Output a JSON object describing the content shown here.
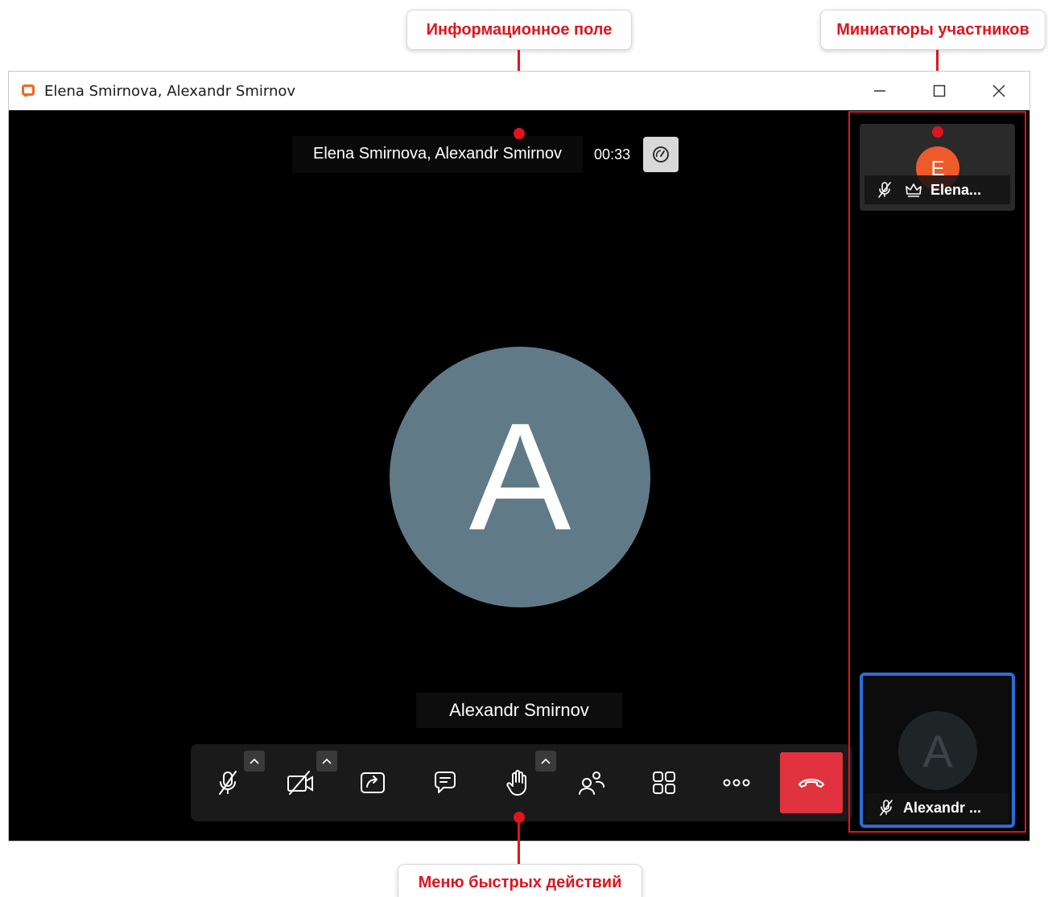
{
  "callouts": {
    "info": "Информационное поле",
    "thumbs": "Миниатюры участников",
    "menu": "Меню быстрых действий"
  },
  "window": {
    "title": "Elena Smirnova, Alexandr Smirnov",
    "controls": [
      "minimize-icon",
      "maximize-icon",
      "close-icon"
    ]
  },
  "info_bar": {
    "names": "Elena Smirnova, Alexandr Smirnov",
    "timer": "00:33"
  },
  "main": {
    "avatar_letter": "A",
    "avatar_color": "#607a87",
    "speaker": "Alexandr Smirnov"
  },
  "toolbar": {
    "buttons": [
      "mic-off-icon",
      "camera-off-icon",
      "share-screen-icon",
      "chat-icon",
      "raise-hand-icon",
      "participants-icon",
      "layout-icon",
      "more-icon",
      "end-call-icon"
    ],
    "end_call_color": "#e0323f"
  },
  "thumbnails": [
    {
      "avatar_letter": "E",
      "avatar_color": "#ef5a2a",
      "name": "Elena..."
    },
    {
      "avatar_letter": "A",
      "avatar_color": "#1f2527",
      "name": "Alexandr ..."
    }
  ],
  "accent": {
    "callout_red": "#e0141e",
    "active_speaker_blue": "#2a6fd8"
  }
}
